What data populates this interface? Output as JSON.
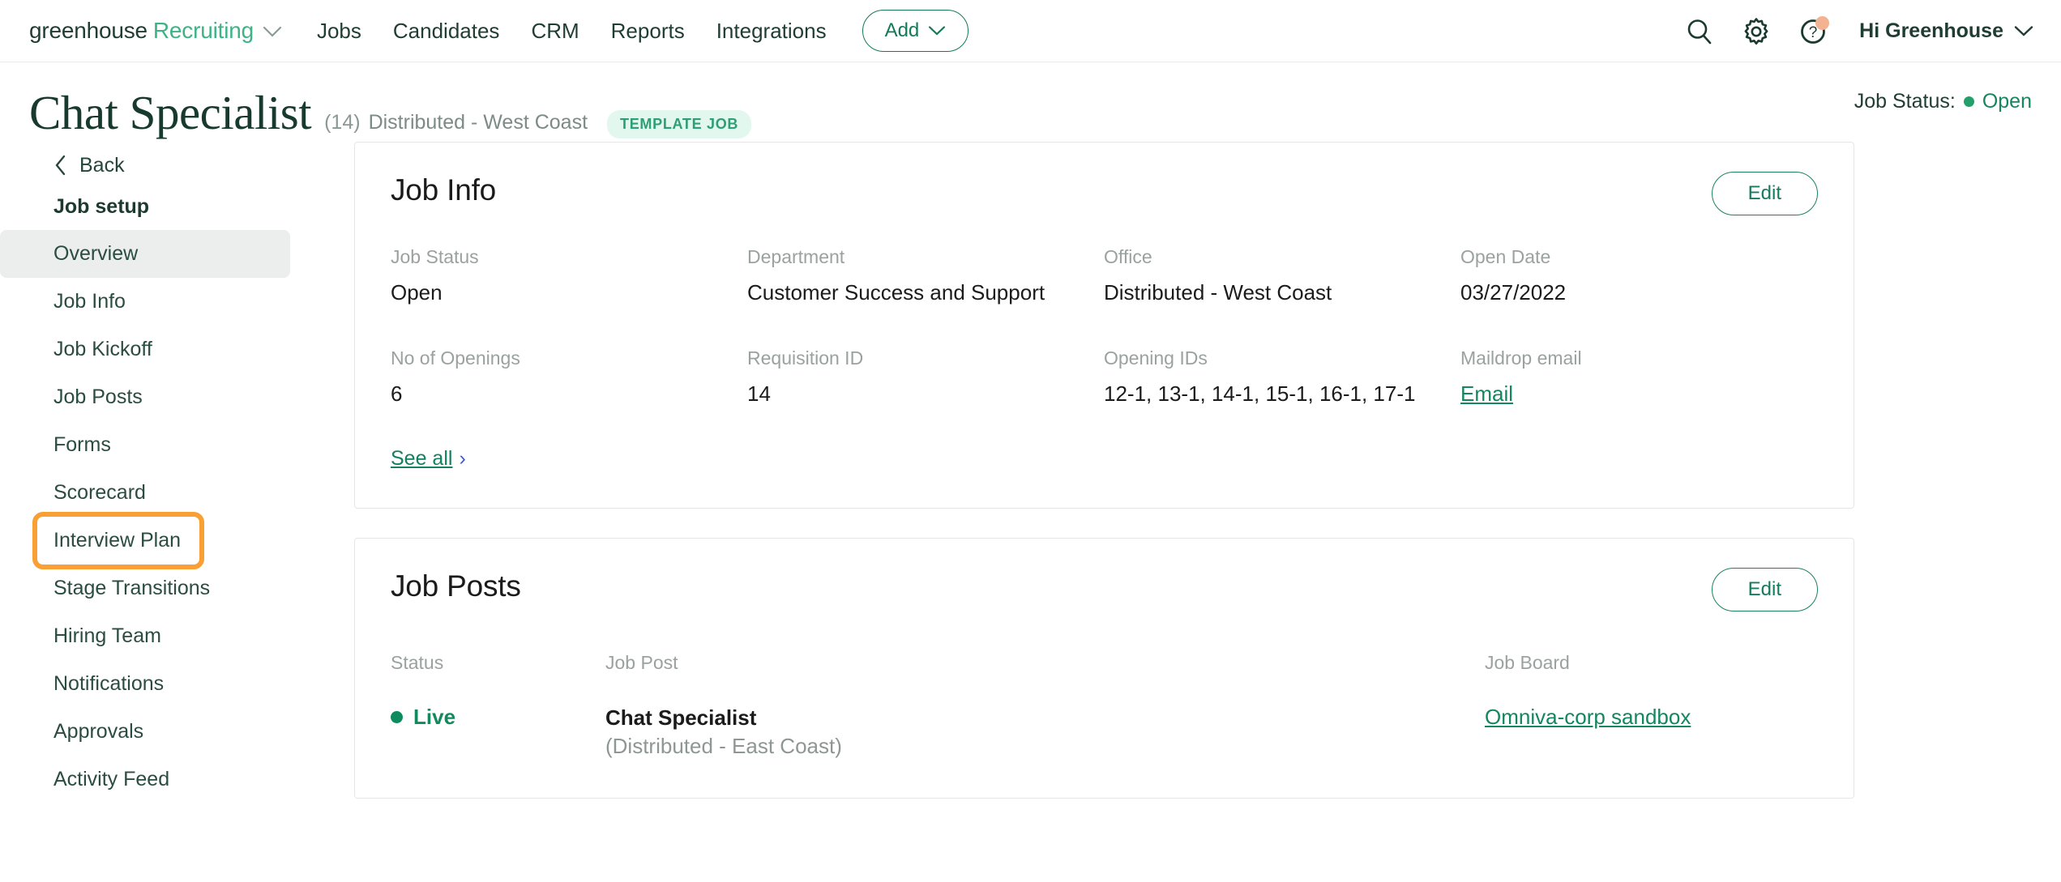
{
  "topnav": {
    "brand_first": "greenhouse",
    "brand_second": "Recruiting",
    "brand_caret": "⌄",
    "links": [
      {
        "label": "Jobs"
      },
      {
        "label": "Candidates"
      },
      {
        "label": "CRM"
      },
      {
        "label": "Reports"
      },
      {
        "label": "Integrations"
      }
    ],
    "add_label": "Add",
    "add_caret": "⌄",
    "greeting": "Hi Greenhouse",
    "greeting_caret": "⌄"
  },
  "page": {
    "title": "Chat Specialist",
    "count": "(14)",
    "office": "Distributed - West Coast",
    "template_badge": "TEMPLATE JOB",
    "job_status_label": "Job Status:",
    "job_status_value": "Open"
  },
  "sidebar": {
    "back_label": "Back",
    "back_chevron": "‹",
    "heading": "Job setup",
    "items": [
      {
        "label": "Overview",
        "active": true
      },
      {
        "label": "Job Info",
        "active": false
      },
      {
        "label": "Job Kickoff",
        "active": false
      },
      {
        "label": "Job Posts",
        "active": false
      },
      {
        "label": "Forms",
        "active": false
      },
      {
        "label": "Scorecard",
        "active": false
      },
      {
        "label": "Interview Plan",
        "active": false
      },
      {
        "label": "Stage Transitions",
        "active": false
      },
      {
        "label": "Hiring Team",
        "active": false
      },
      {
        "label": "Notifications",
        "active": false
      },
      {
        "label": "Approvals",
        "active": false
      },
      {
        "label": "Activity Feed",
        "active": false
      }
    ]
  },
  "job_info": {
    "title": "Job Info",
    "edit_label": "Edit",
    "fields": [
      {
        "label": "Job Status",
        "value": "Open"
      },
      {
        "label": "Department",
        "value": "Customer Success and Support"
      },
      {
        "label": "Office",
        "value": "Distributed - West Coast"
      },
      {
        "label": "Open Date",
        "value": "03/27/2022"
      },
      {
        "label": "No of Openings",
        "value": "6"
      },
      {
        "label": "Requisition ID",
        "value": "14"
      },
      {
        "label": "Opening IDs",
        "value": "12-1, 13-1, 14-1, 15-1, 16-1, 17-1"
      },
      {
        "label": "Maildrop email",
        "value": "Email",
        "is_link": true
      }
    ],
    "see_all_label": "See all",
    "see_all_chevron": "›"
  },
  "job_posts": {
    "title": "Job Posts",
    "edit_label": "Edit",
    "columns": [
      {
        "label": "Status"
      },
      {
        "label": "Job Post"
      },
      {
        "label": "Job Board"
      }
    ],
    "rows": [
      {
        "status": "Live",
        "post_name": "Chat Specialist",
        "post_sub": "(Distributed - East Coast)",
        "job_board": "Omniva-corp sandbox"
      }
    ]
  },
  "colors": {
    "accent_green": "#13875f",
    "brand_green": "#3db387",
    "dark_green": "#1f3d33",
    "annotation_orange": "#f8a033",
    "badge_bg": "#e2f7ee",
    "notif_dot": "#f3b392"
  }
}
